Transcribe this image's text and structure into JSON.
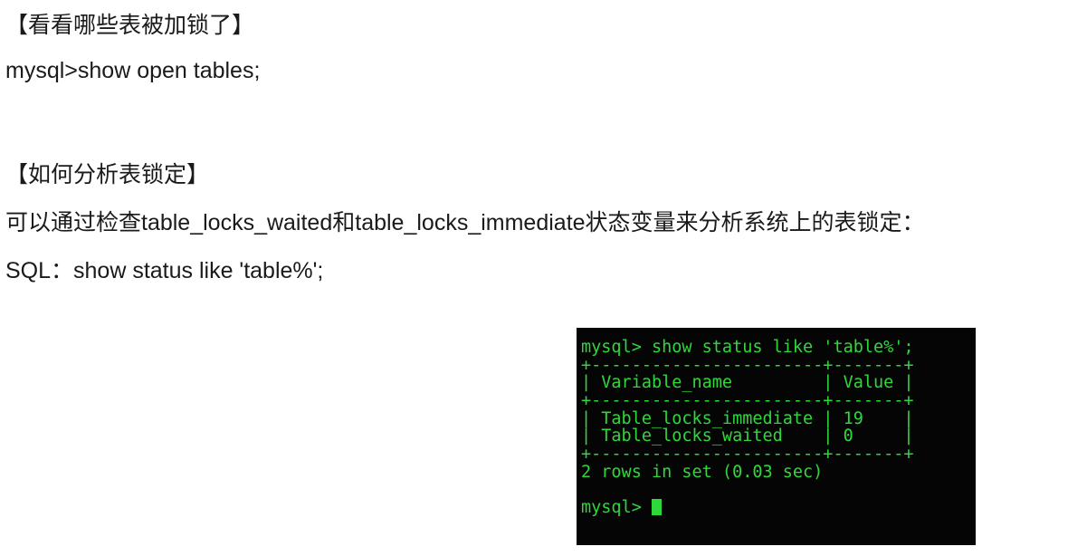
{
  "lines": {
    "heading1": "【看看哪些表被加锁了】",
    "command1": "mysql>show open tables;",
    "heading2": "【如何分析表锁定】",
    "description": "可以通过检查table_locks_waited和table_locks_immediate状态变量来分析系统上的表锁定：",
    "sql": "SQL：show status like 'table%';"
  },
  "terminal": {
    "command": "mysql> show status like 'table%';",
    "border": "+-----------------------+-------+",
    "header": "| Variable_name         | Value |",
    "rows": [
      "| Table_locks_immediate | 19    |",
      "| Table_locks_waited    | 0     |"
    ],
    "result": "2 rows in set (0.03 sec)",
    "prompt": "mysql> ",
    "text_color": "#2fd83a",
    "background_color": "#050505"
  }
}
